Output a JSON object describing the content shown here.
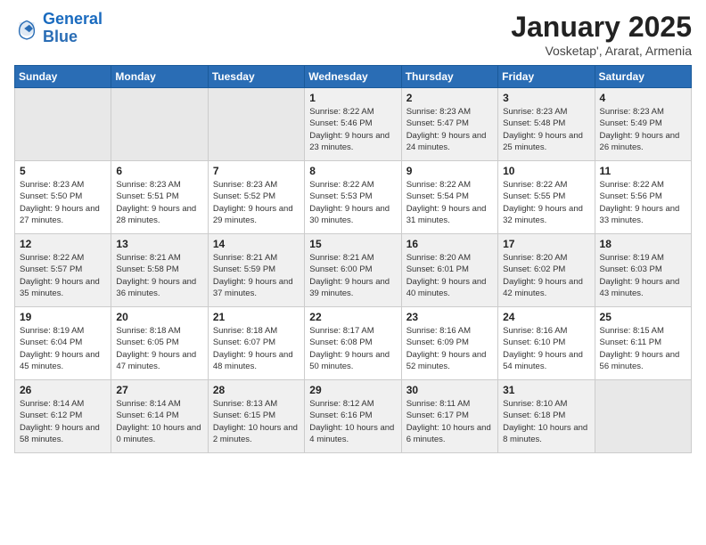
{
  "logo": {
    "line1": "General",
    "line2": "Blue"
  },
  "title": "January 2025",
  "subtitle": "Vosketap', Ararat, Armenia",
  "days_of_week": [
    "Sunday",
    "Monday",
    "Tuesday",
    "Wednesday",
    "Thursday",
    "Friday",
    "Saturday"
  ],
  "weeks": [
    [
      {
        "day": "",
        "empty": true
      },
      {
        "day": "",
        "empty": true
      },
      {
        "day": "",
        "empty": true
      },
      {
        "day": "1",
        "sunrise": "8:22 AM",
        "sunset": "5:46 PM",
        "daylight": "9 hours and 23 minutes."
      },
      {
        "day": "2",
        "sunrise": "8:23 AM",
        "sunset": "5:47 PM",
        "daylight": "9 hours and 24 minutes."
      },
      {
        "day": "3",
        "sunrise": "8:23 AM",
        "sunset": "5:48 PM",
        "daylight": "9 hours and 25 minutes."
      },
      {
        "day": "4",
        "sunrise": "8:23 AM",
        "sunset": "5:49 PM",
        "daylight": "9 hours and 26 minutes."
      }
    ],
    [
      {
        "day": "5",
        "sunrise": "8:23 AM",
        "sunset": "5:50 PM",
        "daylight": "9 hours and 27 minutes."
      },
      {
        "day": "6",
        "sunrise": "8:23 AM",
        "sunset": "5:51 PM",
        "daylight": "9 hours and 28 minutes."
      },
      {
        "day": "7",
        "sunrise": "8:23 AM",
        "sunset": "5:52 PM",
        "daylight": "9 hours and 29 minutes."
      },
      {
        "day": "8",
        "sunrise": "8:22 AM",
        "sunset": "5:53 PM",
        "daylight": "9 hours and 30 minutes."
      },
      {
        "day": "9",
        "sunrise": "8:22 AM",
        "sunset": "5:54 PM",
        "daylight": "9 hours and 31 minutes."
      },
      {
        "day": "10",
        "sunrise": "8:22 AM",
        "sunset": "5:55 PM",
        "daylight": "9 hours and 32 minutes."
      },
      {
        "day": "11",
        "sunrise": "8:22 AM",
        "sunset": "5:56 PM",
        "daylight": "9 hours and 33 minutes."
      }
    ],
    [
      {
        "day": "12",
        "sunrise": "8:22 AM",
        "sunset": "5:57 PM",
        "daylight": "9 hours and 35 minutes."
      },
      {
        "day": "13",
        "sunrise": "8:21 AM",
        "sunset": "5:58 PM",
        "daylight": "9 hours and 36 minutes."
      },
      {
        "day": "14",
        "sunrise": "8:21 AM",
        "sunset": "5:59 PM",
        "daylight": "9 hours and 37 minutes."
      },
      {
        "day": "15",
        "sunrise": "8:21 AM",
        "sunset": "6:00 PM",
        "daylight": "9 hours and 39 minutes."
      },
      {
        "day": "16",
        "sunrise": "8:20 AM",
        "sunset": "6:01 PM",
        "daylight": "9 hours and 40 minutes."
      },
      {
        "day": "17",
        "sunrise": "8:20 AM",
        "sunset": "6:02 PM",
        "daylight": "9 hours and 42 minutes."
      },
      {
        "day": "18",
        "sunrise": "8:19 AM",
        "sunset": "6:03 PM",
        "daylight": "9 hours and 43 minutes."
      }
    ],
    [
      {
        "day": "19",
        "sunrise": "8:19 AM",
        "sunset": "6:04 PM",
        "daylight": "9 hours and 45 minutes."
      },
      {
        "day": "20",
        "sunrise": "8:18 AM",
        "sunset": "6:05 PM",
        "daylight": "9 hours and 47 minutes."
      },
      {
        "day": "21",
        "sunrise": "8:18 AM",
        "sunset": "6:07 PM",
        "daylight": "9 hours and 48 minutes."
      },
      {
        "day": "22",
        "sunrise": "8:17 AM",
        "sunset": "6:08 PM",
        "daylight": "9 hours and 50 minutes."
      },
      {
        "day": "23",
        "sunrise": "8:16 AM",
        "sunset": "6:09 PM",
        "daylight": "9 hours and 52 minutes."
      },
      {
        "day": "24",
        "sunrise": "8:16 AM",
        "sunset": "6:10 PM",
        "daylight": "9 hours and 54 minutes."
      },
      {
        "day": "25",
        "sunrise": "8:15 AM",
        "sunset": "6:11 PM",
        "daylight": "9 hours and 56 minutes."
      }
    ],
    [
      {
        "day": "26",
        "sunrise": "8:14 AM",
        "sunset": "6:12 PM",
        "daylight": "9 hours and 58 minutes."
      },
      {
        "day": "27",
        "sunrise": "8:14 AM",
        "sunset": "6:14 PM",
        "daylight": "10 hours and 0 minutes."
      },
      {
        "day": "28",
        "sunrise": "8:13 AM",
        "sunset": "6:15 PM",
        "daylight": "10 hours and 2 minutes."
      },
      {
        "day": "29",
        "sunrise": "8:12 AM",
        "sunset": "6:16 PM",
        "daylight": "10 hours and 4 minutes."
      },
      {
        "day": "30",
        "sunrise": "8:11 AM",
        "sunset": "6:17 PM",
        "daylight": "10 hours and 6 minutes."
      },
      {
        "day": "31",
        "sunrise": "8:10 AM",
        "sunset": "6:18 PM",
        "daylight": "10 hours and 8 minutes."
      },
      {
        "day": "",
        "empty": true
      }
    ]
  ]
}
